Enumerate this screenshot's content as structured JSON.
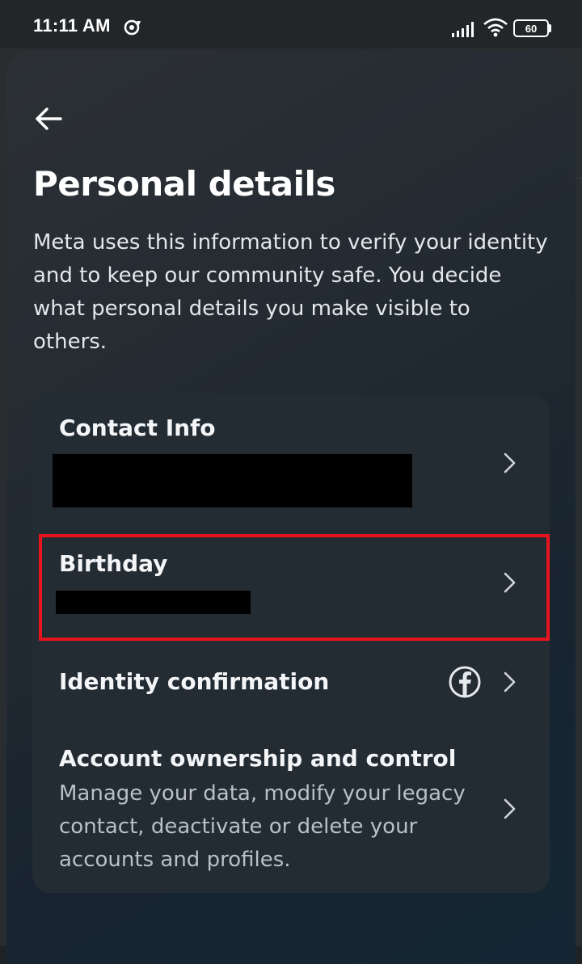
{
  "status_bar": {
    "time": "11:11 AM",
    "battery": "60",
    "icons": [
      "sync-icon",
      "signal-icon",
      "wifi-icon",
      "battery-icon"
    ]
  },
  "header": {
    "back_icon": "arrow-left-icon",
    "title": "Personal details",
    "description": "Meta uses this information to verify your identity and to keep our community safe. You decide what personal details you make visible to others."
  },
  "items": [
    {
      "title": "Contact Info",
      "value_redacted": true,
      "icon": "chevron-right-icon"
    },
    {
      "title": "Birthday",
      "value_redacted": true,
      "icon": "chevron-right-icon",
      "highlighted": true
    },
    {
      "title": "Identity confirmation",
      "badge_icon": "facebook-icon",
      "icon": "chevron-right-icon"
    },
    {
      "title": "Account ownership and control",
      "subtitle": "Manage your data, modify your legacy contact, deactivate or delete your accounts and profiles.",
      "icon": "chevron-right-icon"
    }
  ],
  "colors": {
    "highlight": "#e8141c",
    "card": "#232b33",
    "text": "#ffffff"
  }
}
